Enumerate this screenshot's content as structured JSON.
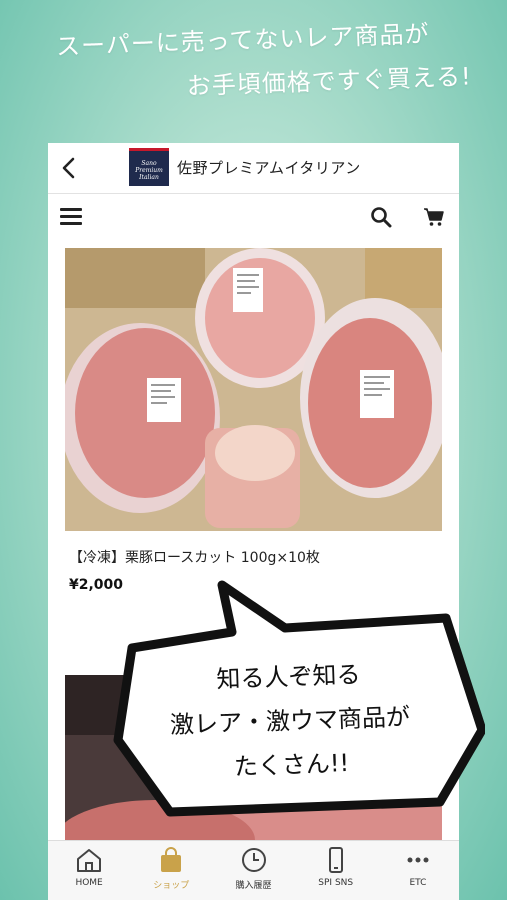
{
  "headline": {
    "line1": "スーパーに売ってないレア商品が",
    "line2": "お手頃価格ですぐ買える!"
  },
  "app": {
    "logo_text": [
      "Sano",
      "Premium",
      "Italian"
    ],
    "name": "佐野プレミアムイタリアン"
  },
  "product": {
    "title": "【冷凍】栗豚ロースカット 100g×10枚",
    "price": "¥2,000"
  },
  "bubble": {
    "line1": "知る人ぞ知る",
    "line2": "激レア・激ウマ商品が",
    "line3": "たくさん!!"
  },
  "tabs": [
    {
      "label": "HOME",
      "icon": "home-icon"
    },
    {
      "label": "ショップ",
      "icon": "shopping-bag-icon",
      "active": true
    },
    {
      "label": "購入履歴",
      "icon": "clock-icon"
    },
    {
      "label": "SPI SNS",
      "icon": "smartphone-icon"
    },
    {
      "label": "ETC",
      "icon": "more-dots-icon"
    }
  ],
  "colors": {
    "background_teal": "#6cc2ad",
    "logo_navy": "#1f2a4d",
    "logo_red": "#c6182b",
    "active_tab": "#c9a24a"
  }
}
